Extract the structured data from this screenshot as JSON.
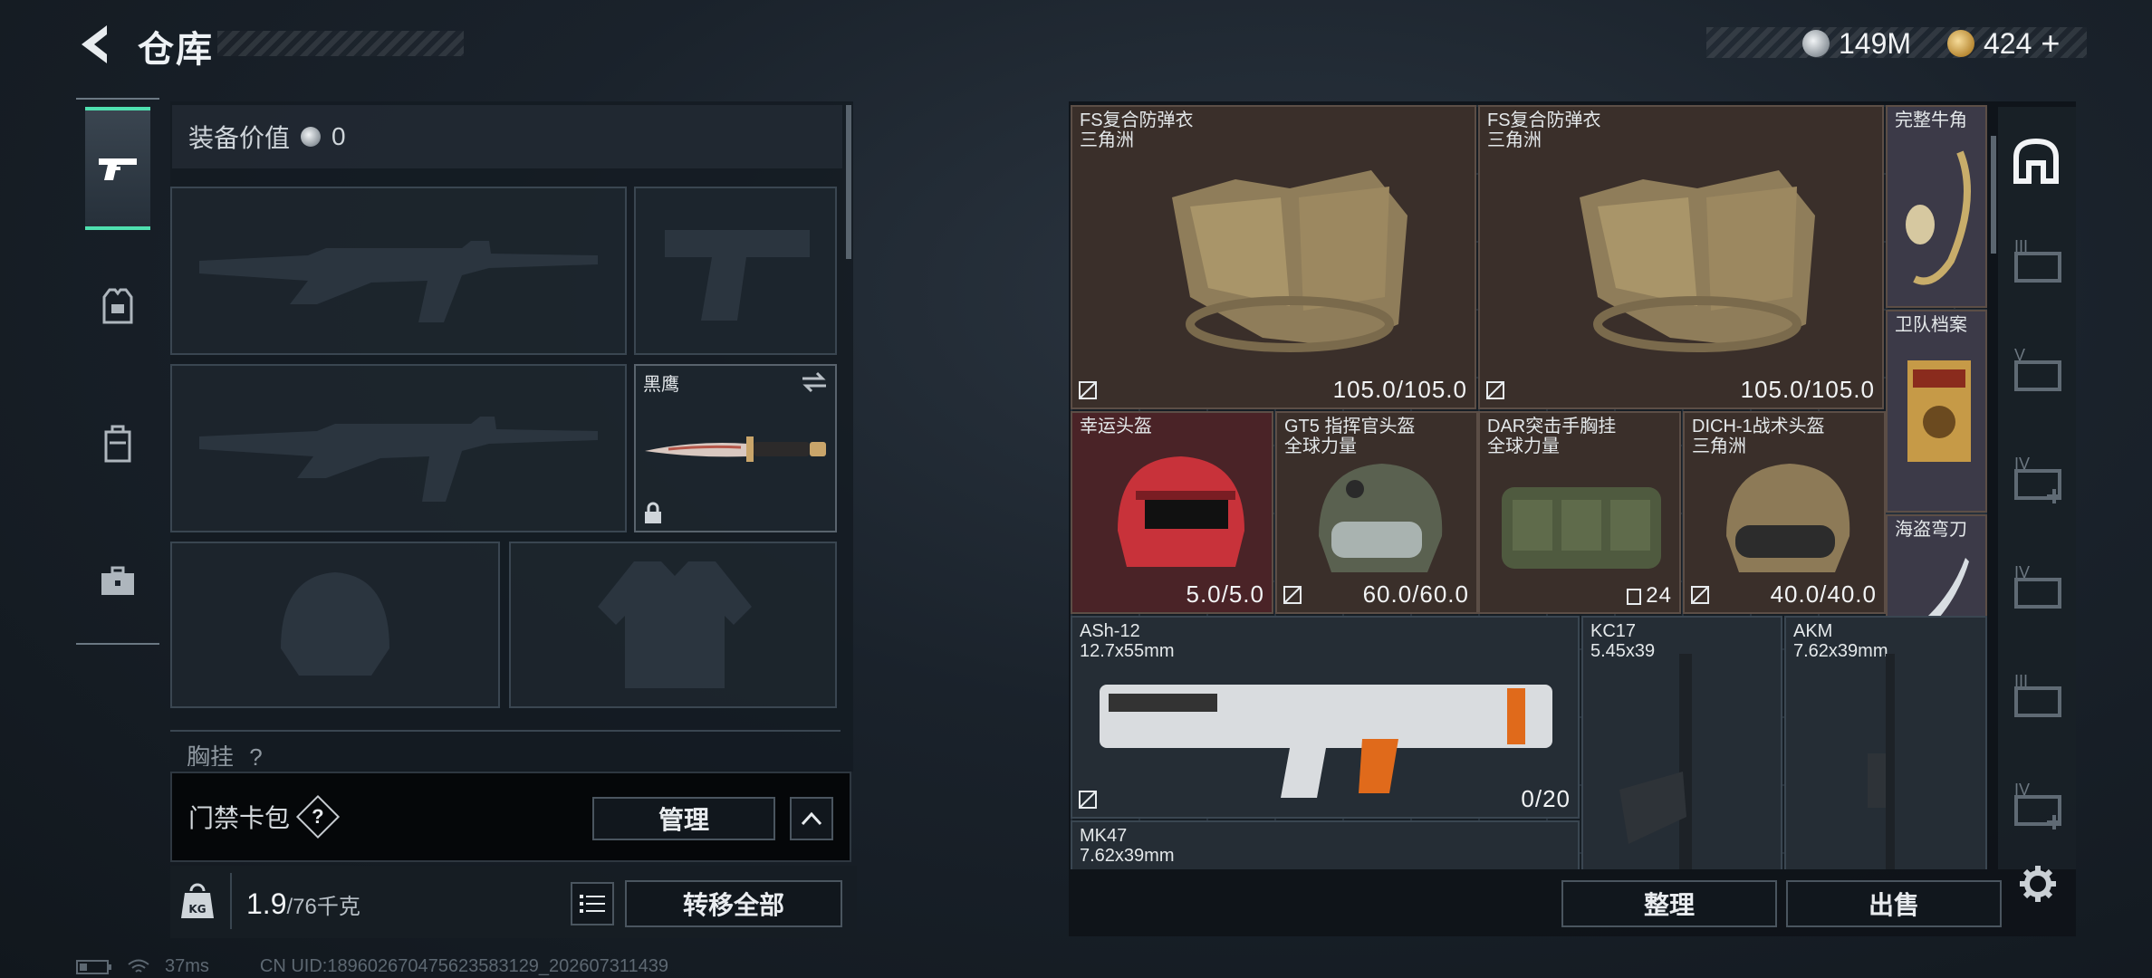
{
  "header": {
    "title": "仓库"
  },
  "currency": {
    "silver": "149M",
    "gold": "424",
    "add_label": "+"
  },
  "equipment": {
    "value_label": "装备价值",
    "value": "0",
    "knife_name": "黑鹰",
    "rig_label": "胸挂",
    "rig_hint": "?"
  },
  "cardbag": {
    "label": "门禁卡包",
    "help": "?",
    "manage_label": "管理"
  },
  "weight": {
    "current": "1.9",
    "max": "/76千克",
    "transfer_all_label": "转移全部"
  },
  "stash": {
    "items": [
      {
        "name": "FS复合防弹衣",
        "sub": "三角洲",
        "value": "105.0/105.0"
      },
      {
        "name": "FS复合防弹衣",
        "sub": "三角洲",
        "value": "105.0/105.0"
      },
      {
        "name": "完整牛角",
        "sub": "",
        "value": ""
      },
      {
        "name": "卫队档案",
        "sub": "",
        "value": ""
      },
      {
        "name": "海盗弯刀",
        "sub": "",
        "value": ""
      },
      {
        "name": "幸运头盔",
        "sub": "",
        "value": "5.0/5.0"
      },
      {
        "name": "GT5 指挥官头盔",
        "sub": "全球力量",
        "value": "60.0/60.0"
      },
      {
        "name": "DAR突击手胸挂",
        "sub": "全球力量",
        "value": "24"
      },
      {
        "name": "DICH-1战术头盔",
        "sub": "三角洲",
        "value": "40.0/40.0"
      },
      {
        "name": "ASh-12",
        "sub": "12.7x55mm",
        "value": "0/20"
      },
      {
        "name": "KC17",
        "sub": "5.45x39",
        "value": ""
      },
      {
        "name": "AKM",
        "sub": "7.62x39mm",
        "value": ""
      },
      {
        "name": "MK47",
        "sub": "7.62x39mm",
        "value": ""
      }
    ],
    "sort_label": "整理",
    "sell_label": "出售"
  },
  "side_tabs": [
    "III",
    "V",
    "IV",
    "IV",
    "III",
    "IV"
  ],
  "status": {
    "ping": "37ms",
    "uid": "CN UID:18960267047562358312​9_202607311439"
  }
}
